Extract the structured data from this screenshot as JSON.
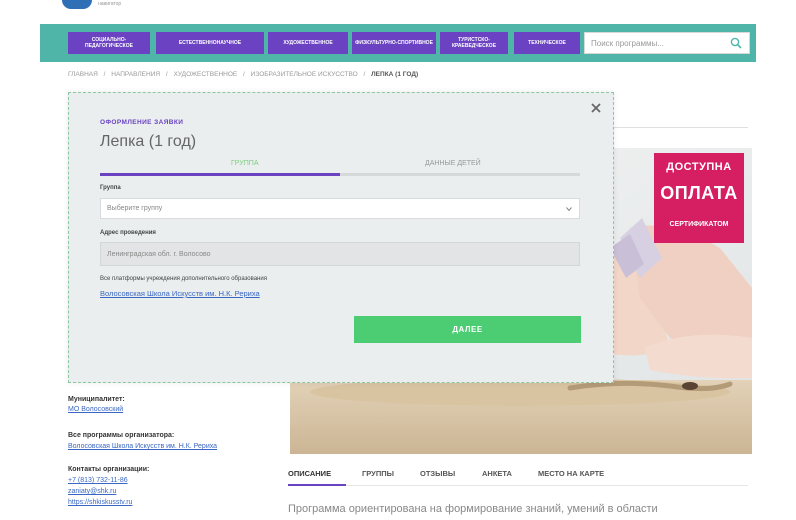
{
  "header": {
    "logo_text": "навигатор",
    "nav": [
      {
        "label": "Социально-педагогическое"
      },
      {
        "label": "Естественнонаучное"
      },
      {
        "label": "Художественное"
      },
      {
        "label": "Физкультурно-спортивное"
      },
      {
        "label": "Туристско-краеведческое"
      },
      {
        "label": "Техническое"
      }
    ],
    "search_placeholder": "Поиск программы..."
  },
  "breadcrumb": [
    "Главная",
    "/",
    "Направления",
    "/",
    "Художественное",
    "/",
    "Изобразительное искусство",
    "/",
    "Лепка (1 год)"
  ],
  "promo": {
    "line1": "ДОСТУПНА",
    "line2": "ОПЛАТА",
    "line3": "СЕРТИФИКАТОМ"
  },
  "sidebar": {
    "municipality_label": "Муниципалитет:",
    "municipality_value": "МО Волосовский",
    "all_programs_label": "Все программы организатора:",
    "all_programs_value": "Волосовская Школа Искусств им. Н.К. Рериха",
    "contacts_label": "Контакты организации:",
    "phone": "+7 (813) 732-11-86",
    "email": "zaniaty@shk.ru",
    "site": "https://shkiskusstv.ru"
  },
  "tabs": [
    {
      "label": "Описание",
      "active": true
    },
    {
      "label": "Группы",
      "active": false
    },
    {
      "label": "Отзывы",
      "active": false
    },
    {
      "label": "Анкета",
      "active": false
    },
    {
      "label": "Место на карте",
      "active": false
    }
  ],
  "description": "Программа ориентирована на формирование знаний, умений в области",
  "modal": {
    "subtitle": "Оформление заявки",
    "title": "Лепка (1 год)",
    "steps": [
      {
        "label": "Группа",
        "active": true
      },
      {
        "label": "Данные детей",
        "active": false
      }
    ],
    "group_label": "Группа",
    "group_placeholder": "Выберите группу",
    "address_label": "Адрес проведения",
    "address_value": "Ленинградская обл. г. Волосово",
    "agreement_text": "Все платформы учреждения дополнительного образования",
    "agreement_link": "Волосовская Школа Искусств им. Н.К. Рериха",
    "next_label": "Далее"
  },
  "colors": {
    "nav_bar": "#4fb5a8",
    "nav_item": "#6a42c2",
    "accent": "#6a42c2",
    "promo": "#d61f63",
    "button": "#4ccc73",
    "link": "#3a67c3"
  }
}
